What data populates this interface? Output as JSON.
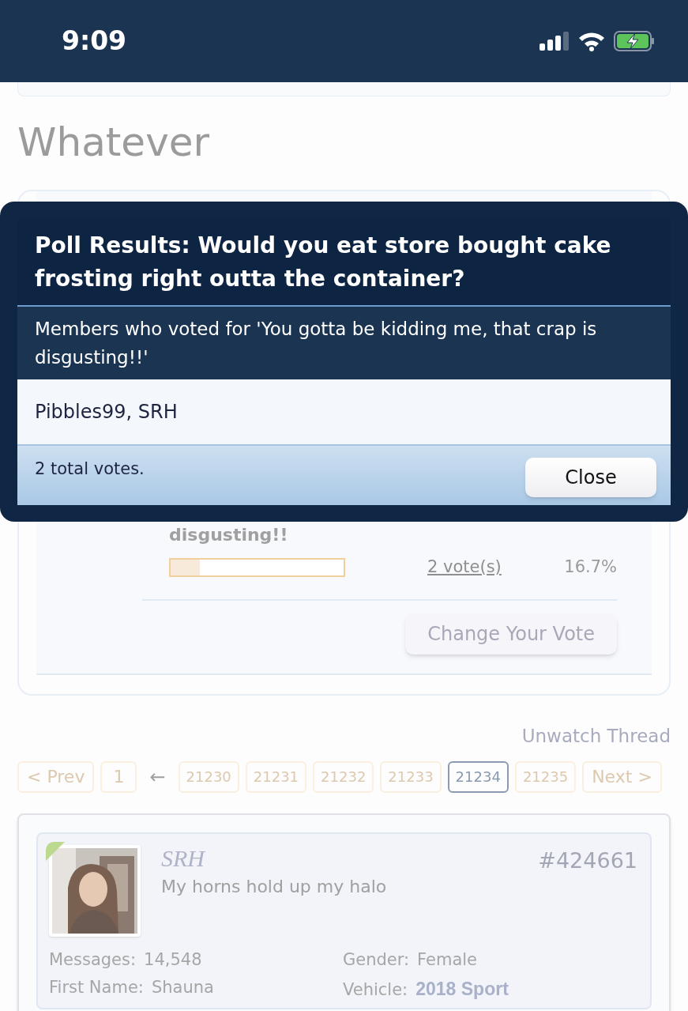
{
  "status_bar": {
    "time": "9:09"
  },
  "page_title": "Whatever",
  "poll": {
    "option_text_tail": "disgusting!!",
    "level": 0.167,
    "votes_link": "2 vote(s)",
    "percent": "16.7%",
    "change_vote_button": "Change Your Vote"
  },
  "thread_actions": {
    "unwatch_link": "Unwatch Thread"
  },
  "pagination": {
    "prev": "< Prev",
    "first": "1",
    "gap": "←",
    "pages": [
      {
        "label": "21230",
        "selected": false
      },
      {
        "label": "21231",
        "selected": false
      },
      {
        "label": "21232",
        "selected": false
      },
      {
        "label": "21233",
        "selected": false
      },
      {
        "label": "21234",
        "selected": true
      },
      {
        "label": "21235",
        "selected": false
      }
    ],
    "next": "Next >"
  },
  "post": {
    "username": "SRH",
    "user_title": "My horns hold up my halo",
    "post_number": "#424661",
    "online": true,
    "fields": [
      {
        "label": "Messages:",
        "value": "14,548",
        "kind": "plain"
      },
      {
        "label": "Gender:",
        "value": "Female",
        "kind": "plain"
      },
      {
        "label": "First Name:",
        "value": "Shauna",
        "kind": "plain"
      },
      {
        "label": "Vehicle:",
        "value": "2018 Sport",
        "kind": "bold"
      }
    ]
  },
  "modal": {
    "title": "Poll Results: Would you eat store bought cake frosting right outta the container?",
    "subtitle": "Members who voted for 'You gotta be kidding me, that crap is disgusting!!'",
    "voters": "Pibbles99, SRH",
    "total": "2 total votes.",
    "close_button": "Close"
  }
}
